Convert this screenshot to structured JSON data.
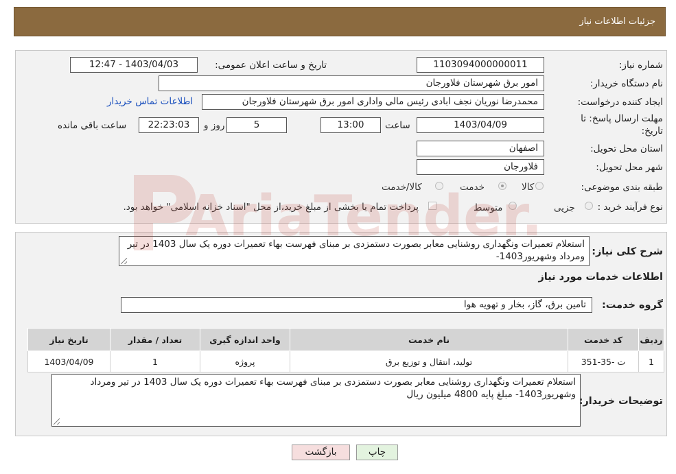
{
  "header": {
    "title": "جزئیات اطلاعات نیاز"
  },
  "form": {
    "need_number_label": "شماره نیاز:",
    "need_number": "1103094000000011",
    "announce_label": "تاریخ و ساعت اعلان عمومی:",
    "announce_value": "1403/04/03 - 12:47",
    "buyer_org_label": "نام دستگاه خریدار:",
    "buyer_org": "امور برق شهرستان فلاورجان",
    "creator_label": "ایجاد کننده درخواست:",
    "creator": "محمدرضا نوریان نجف ابادی رئیس مالی واداری  امور برق شهرستان فلاورجان",
    "contact_link": "اطلاعات تماس خریدار",
    "deadline_label_1": "مهلت ارسال پاسخ: تا",
    "deadline_label_2": "تاریخ:",
    "deadline_date": "1403/04/09",
    "time_label": "ساعت",
    "deadline_time": "13:00",
    "days": "5",
    "days_label": "روز و",
    "remaining": "22:23:03",
    "remaining_label": "ساعت باقی مانده",
    "province_label": "استان محل تحویل:",
    "province": "اصفهان",
    "city_label": "شهر محل تحویل:",
    "city": "فلاورجان",
    "category_label": "طبقه بندی موضوعی:",
    "category_options": [
      "کالا",
      "خدمت",
      "کالا/خدمت"
    ],
    "category_selected": "خدمت",
    "process_label": "نوع فرآیند خرید :",
    "process_options": [
      "جزیی",
      "متوسط"
    ],
    "payment_note": "پرداخت تمام یا بخشی از مبلغ خرید،از محل \"اسناد خزانه اسلامی\" خواهد بود."
  },
  "details": {
    "summary_label": "شرح کلی نیاز:",
    "summary": "استعلام تعمیرات ونگهداری روشنایی معابر بصورت دستمزدی بر مبنای فهرست بهاء تعمیرات دوره یک سال 1403 در تیر ومرداد وشهریور1403-",
    "services_heading": "اطلاعات خدمات مورد نیاز",
    "service_group_label": "گروه خدمت:",
    "service_group": "تامین برق، گاز، بخار و تهویه هوا",
    "table": {
      "headers": [
        "ردیف",
        "کد خدمت",
        "نام خدمت",
        "واحد اندازه گیری",
        "تعداد / مقدار",
        "تاریخ نیاز"
      ],
      "rows": [
        [
          "1",
          "ت -35-351",
          "تولید، انتقال و توزیع برق",
          "پروژه",
          "1",
          "1403/04/09"
        ]
      ]
    },
    "buyer_notes_label": "توضیحات خریدار:",
    "buyer_notes": "استعلام تعمیرات ونگهداری روشنایی معابر بصورت دستمزدی بر مبنای فهرست بهاء تعمیرات دوره یک سال 1403 در تیر ومرداد وشهریور1403- مبلغ پایه 4800 میلیون ریال"
  },
  "buttons": {
    "print": "چاپ",
    "back": "بازگشت"
  },
  "watermark": {
    "text": "AriaTender.neT"
  },
  "colors": {
    "header": "#8b6a3f",
    "panel": "#f2f2f2",
    "link": "#1a4fbd",
    "back_button": "#f6dede",
    "print_button": "#e3f3df",
    "watermark": "#c0392b"
  }
}
